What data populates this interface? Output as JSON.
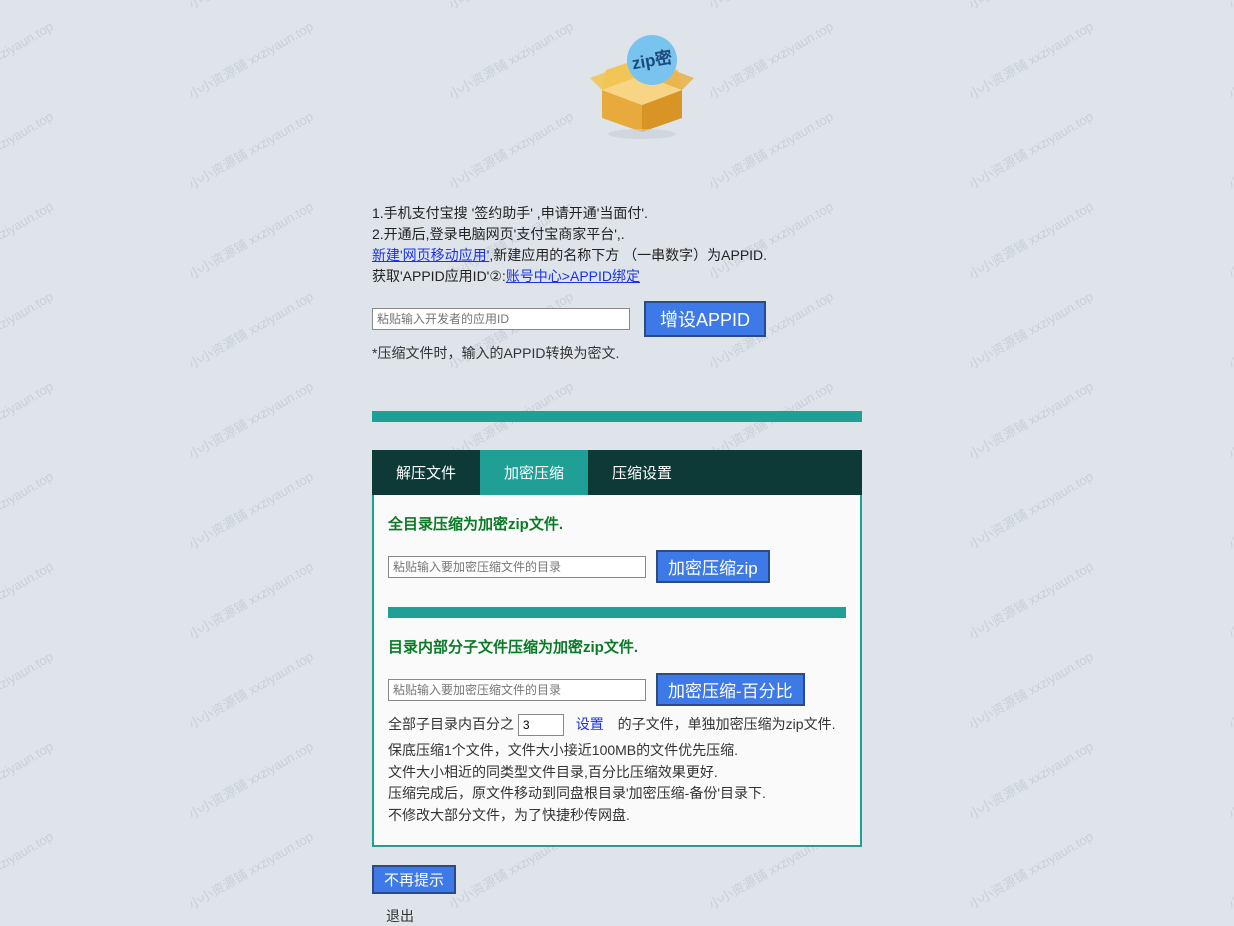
{
  "watermark": "小小资源铺 xxziyaun.top",
  "logo": {
    "badge": "zip密"
  },
  "intro": {
    "line1": "1.手机支付宝搜 '签约助手' ,申请开通'当面付'.",
    "line2": "2.开通后,登录电脑网页'支付宝商家平台',.",
    "link1": "新建'网页移动应用'",
    "line3_mid": ",新建应用的名称下方 （一串数字）为APPID.",
    "line4_pre": "获取'APPID应用ID'②:",
    "link2": "账号中心>APPID绑定"
  },
  "appid": {
    "placeholder": "粘贴输入开发者的应用ID",
    "button": "增设APPID",
    "note": "*压缩文件时，输入的APPID转换为密文."
  },
  "tabs": {
    "t1": "解压文件",
    "t2": "加密压缩",
    "t3": "压缩设置"
  },
  "section1": {
    "title": "全目录压缩为加密zip文件.",
    "placeholder": "粘贴输入要加密压缩文件的目录",
    "button": "加密压缩zip"
  },
  "section2": {
    "title": "目录内部分子文件压缩为加密zip文件.",
    "placeholder": "粘贴输入要加密压缩文件的目录",
    "button": "加密压缩-百分比",
    "row_pre": "全部子目录内百分之",
    "percent_value": "3",
    "set": "设置",
    "row_post": "的子文件，单独加密压缩为zip文件.",
    "desc1": "保底压缩1个文件，文件大小接近100MB的文件优先压缩.",
    "desc2": "文件大小相近的同类型文件目录,百分比压缩效果更好.",
    "desc3": "压缩完成后，原文件移动到同盘根目录'加密压缩-备份'目录下.",
    "desc4": "不修改大部分文件，为了快捷秒传网盘."
  },
  "footer": {
    "no_prompt": "不再提示",
    "exit": "退出"
  }
}
